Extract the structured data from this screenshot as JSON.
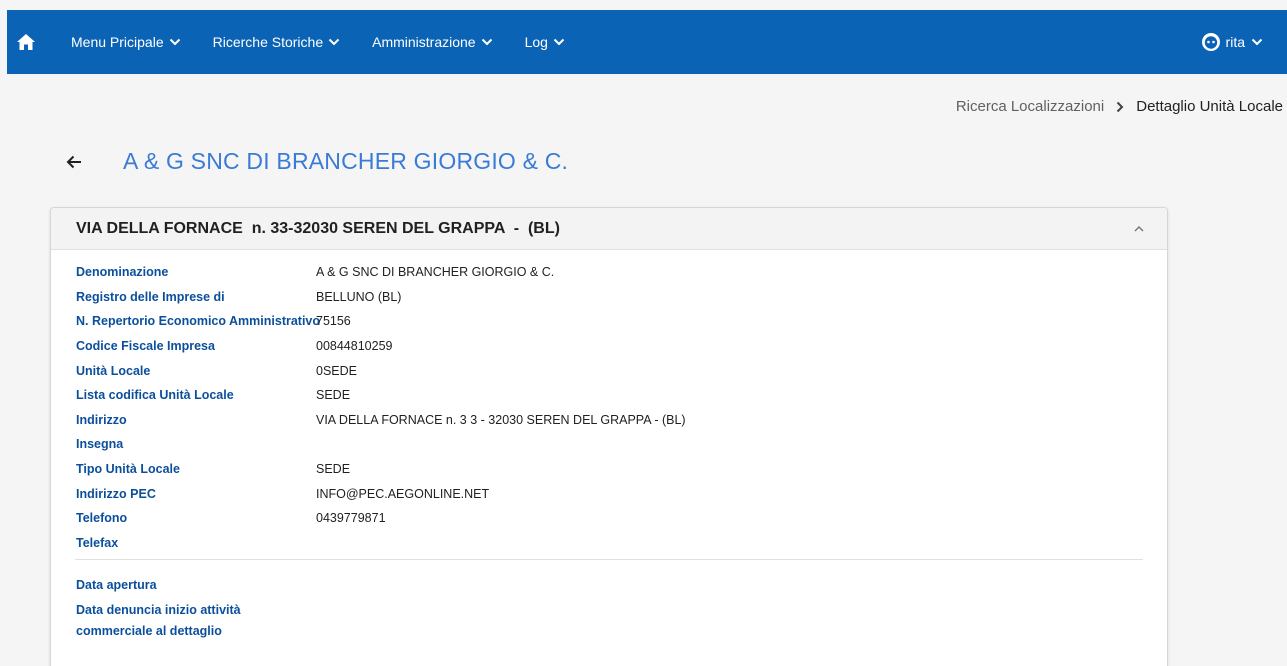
{
  "nav": {
    "menus": [
      {
        "label": "Menu Pricipale"
      },
      {
        "label": "Ricerche Storiche"
      },
      {
        "label": "Amministrazione"
      },
      {
        "label": "Log"
      }
    ],
    "user": "rita"
  },
  "breadcrumb": {
    "parent": "Ricerca Localizzazioni",
    "current": "Dettaglio Unità Locale"
  },
  "page_title": "A & G SNC DI BRANCHER GIORGIO & C.",
  "card": {
    "header": "VIA DELLA FORNACE  n. 33-32030 SEREN DEL GRAPPA  -  (BL)",
    "fields": [
      {
        "label": "Denominazione",
        "value": "A & G SNC DI BRANCHER GIORGIO & C."
      },
      {
        "label": "Registro delle Imprese di",
        "value": "BELLUNO (BL)"
      },
      {
        "label": "N. Repertorio Economico Amministrativo",
        "value": "75156"
      },
      {
        "label": "Codice Fiscale Impresa",
        "value": "00844810259"
      },
      {
        "label": "Unità Locale",
        "value": "0SEDE"
      },
      {
        "label": "Lista codifica Unità Locale",
        "value": "SEDE"
      },
      {
        "label": "Indirizzo",
        "value": "VIA DELLA FORNACE n. 3 3 - 32030 SEREN DEL GRAPPA - (BL)"
      },
      {
        "label": "Insegna",
        "value": ""
      },
      {
        "label": "Tipo Unità Locale",
        "value": "SEDE"
      },
      {
        "label": "Indirizzo PEC",
        "value": "INFO@PEC.AEGONLINE.NET"
      },
      {
        "label": "Telefono",
        "value": "0439779871"
      },
      {
        "label": "Telefax",
        "value": ""
      }
    ],
    "dates": [
      {
        "label": "Data apertura",
        "value": ""
      },
      {
        "label": "Data denuncia inizio attività commerciale al dettaglio",
        "value": ""
      }
    ]
  },
  "colors": {
    "topbar": "#0b63b5",
    "title": "#3a7bd5",
    "label": "#0b4f9c"
  },
  "icons": {
    "home": "home-icon",
    "chevron": "chevron-down-icon",
    "user": "user-face-icon",
    "back": "arrow-left-icon",
    "collapse": "chevron-up-icon",
    "separator": "chevron-right-icon"
  }
}
